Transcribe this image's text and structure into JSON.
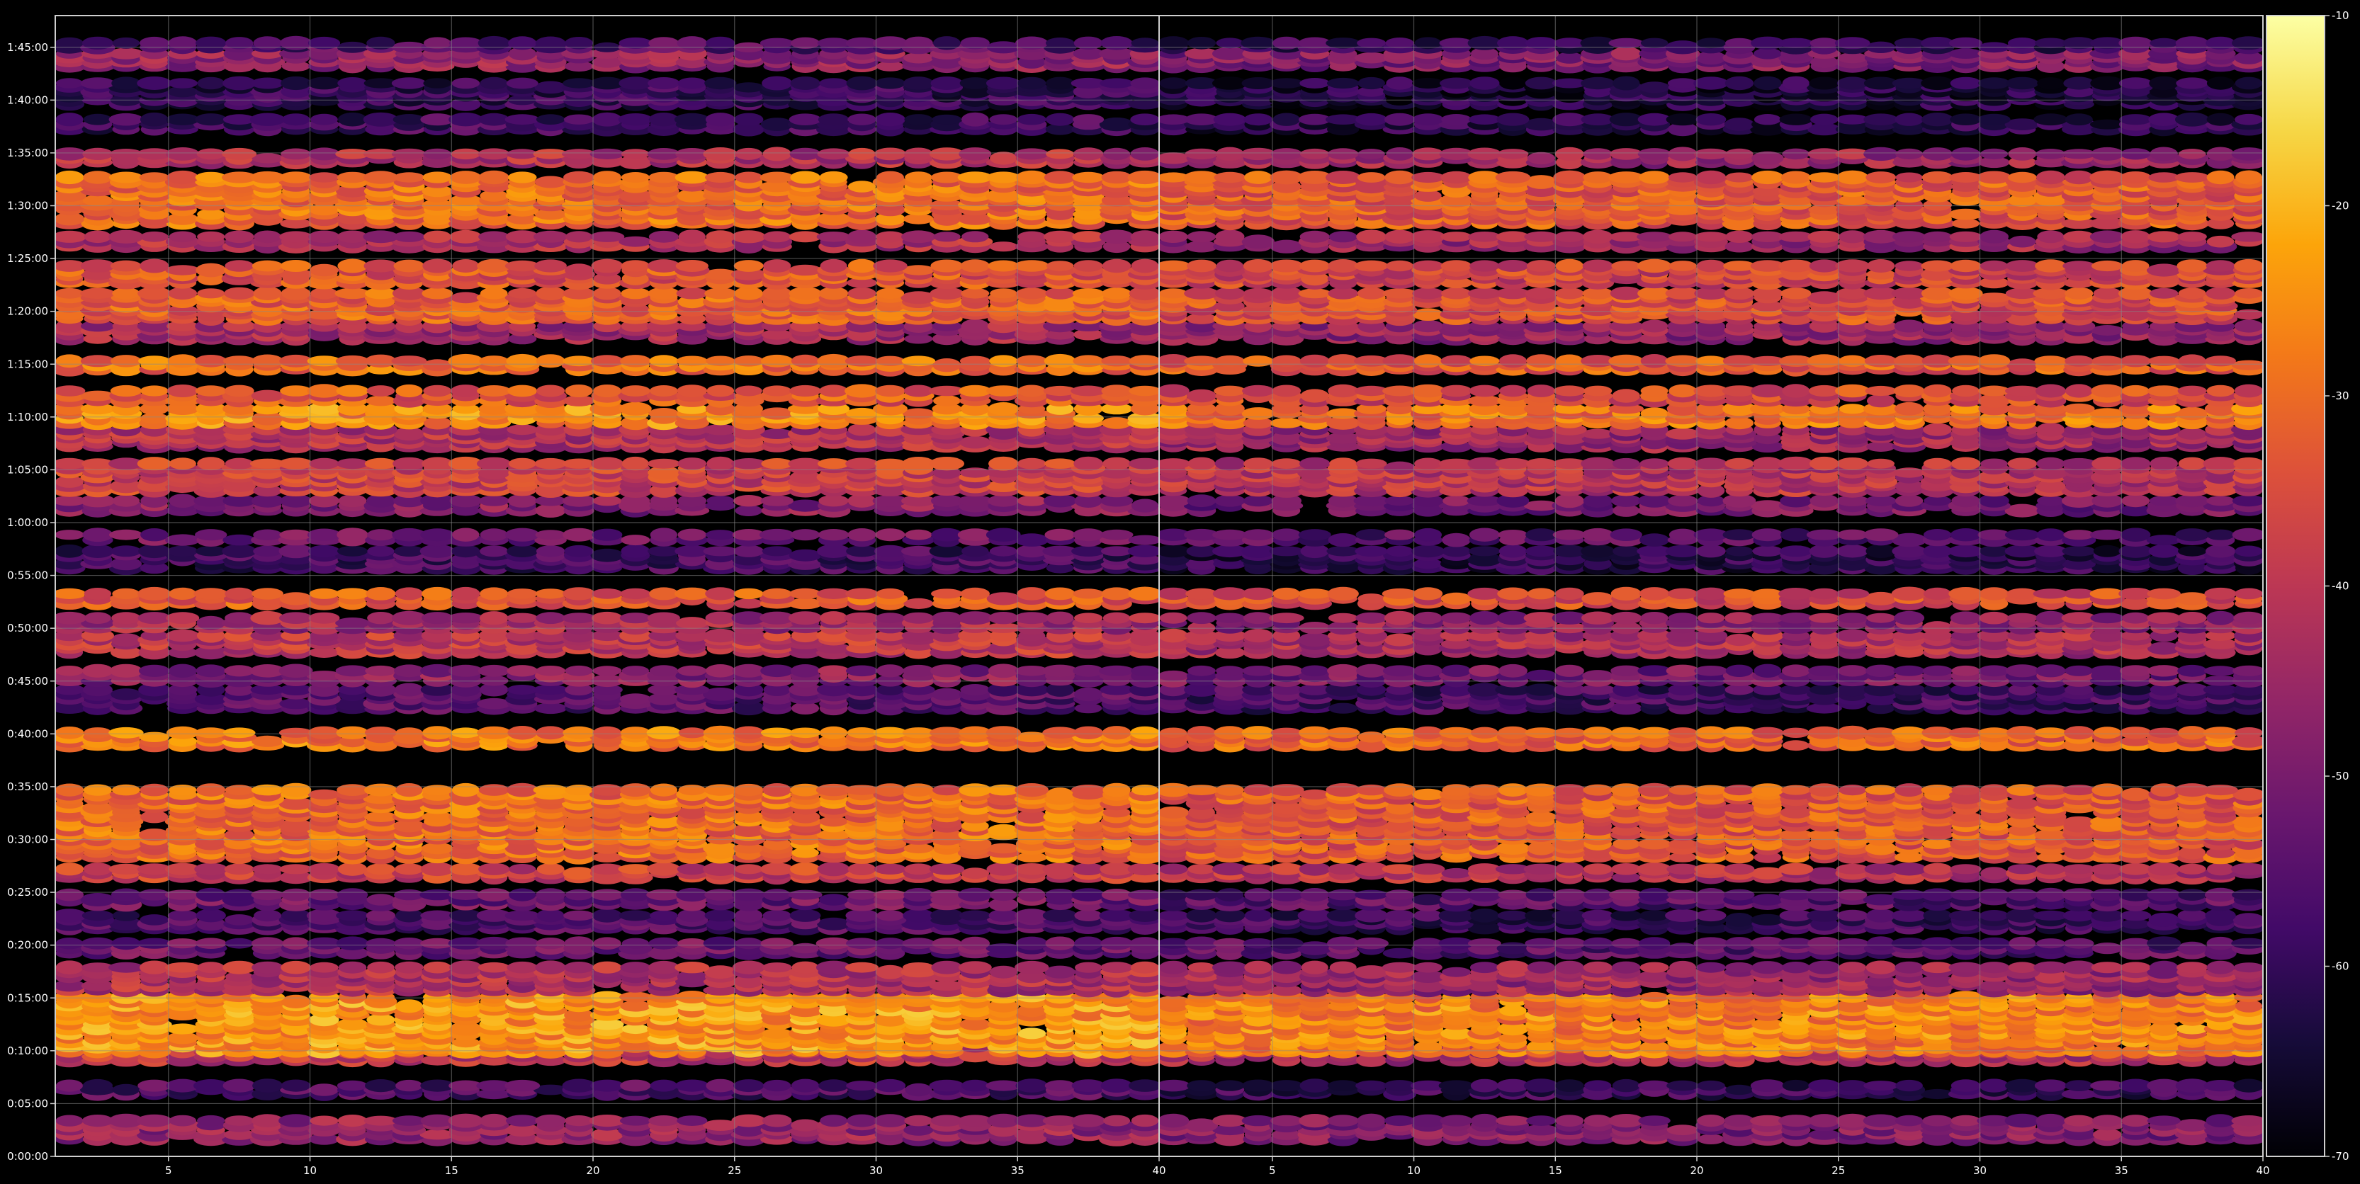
{
  "chart_data": {
    "type": "heatmap",
    "title": "",
    "xlabel": "",
    "ylabel": "",
    "grid": true,
    "background": "#000000",
    "colormap": "inferno",
    "colorbar": {
      "range": [
        -70,
        -10
      ],
      "ticks": [
        "-10",
        "-20",
        "-30",
        "-40",
        "-50",
        "-60",
        "-70"
      ]
    },
    "y_axis": {
      "unit": "elapsed time h:mm:ss",
      "range_seconds": [
        0,
        6480
      ],
      "ticks": [
        "0:00:00",
        "0:05:00",
        "0:10:00",
        "0:15:00",
        "0:20:00",
        "0:25:00",
        "0:30:00",
        "0:35:00",
        "0:40:00",
        "0:45:00",
        "0:50:00",
        "0:55:00",
        "1:00:00",
        "1:05:00",
        "1:10:00",
        "1:15:00",
        "1:20:00",
        "1:25:00",
        "1:30:00",
        "1:35:00",
        "1:40:00",
        "1:45:00"
      ]
    },
    "x_axis": {
      "panels": 2,
      "range": [
        1,
        40
      ],
      "ticks": [
        "5",
        "10",
        "15",
        "20",
        "25",
        "30",
        "35",
        "40"
      ]
    },
    "bands_minutes": [
      {
        "center": 2.5,
        "level": -46,
        "width": 2.2
      },
      {
        "center": 6.3,
        "level": -56,
        "width": 1.2
      },
      {
        "center": 9.7,
        "level": -40,
        "width": 1.6
      },
      {
        "center": 12.5,
        "level": -24,
        "width": 5.6
      },
      {
        "center": 16.8,
        "level": -42,
        "width": 2.6
      },
      {
        "center": 19.7,
        "level": -52,
        "width": 1.4
      },
      {
        "center": 22.2,
        "level": -56,
        "width": 1.6
      },
      {
        "center": 24.3,
        "level": -52,
        "width": 1.4
      },
      {
        "center": 26.8,
        "level": -38,
        "width": 1.2
      },
      {
        "center": 31.5,
        "level": -30,
        "width": 6.8
      },
      {
        "center": 39.5,
        "level": -28,
        "width": 1.6
      },
      {
        "center": 43.3,
        "level": -55,
        "width": 2.2
      },
      {
        "center": 45.5,
        "level": -48,
        "width": 1.4
      },
      {
        "center": 48.5,
        "level": -40,
        "width": 2.0
      },
      {
        "center": 50.5,
        "level": -44,
        "width": 1.4
      },
      {
        "center": 52.8,
        "level": -33,
        "width": 1.4
      },
      {
        "center": 56.5,
        "level": -58,
        "width": 2.0
      },
      {
        "center": 58.6,
        "level": -52,
        "width": 1.0
      },
      {
        "center": 61.6,
        "level": -48,
        "width": 1.4
      },
      {
        "center": 64.3,
        "level": -38,
        "width": 3.0
      },
      {
        "center": 68.0,
        "level": -42,
        "width": 2.0
      },
      {
        "center": 70.1,
        "level": -26,
        "width": 1.8
      },
      {
        "center": 72.0,
        "level": -33,
        "width": 1.4
      },
      {
        "center": 74.9,
        "level": -30,
        "width": 1.2
      },
      {
        "center": 78.0,
        "level": -44,
        "width": 1.6
      },
      {
        "center": 80.5,
        "level": -32,
        "width": 2.8
      },
      {
        "center": 83.5,
        "level": -34,
        "width": 2.0
      },
      {
        "center": 86.6,
        "level": -42,
        "width": 1.4
      },
      {
        "center": 90.5,
        "level": -30,
        "width": 4.8
      },
      {
        "center": 94.5,
        "level": -42,
        "width": 1.2
      },
      {
        "center": 97.7,
        "level": -58,
        "width": 1.4
      },
      {
        "center": 100.6,
        "level": -60,
        "width": 2.4
      },
      {
        "center": 103.8,
        "level": -46,
        "width": 1.6
      },
      {
        "center": 105.2,
        "level": -56,
        "width": 0.8
      }
    ]
  }
}
